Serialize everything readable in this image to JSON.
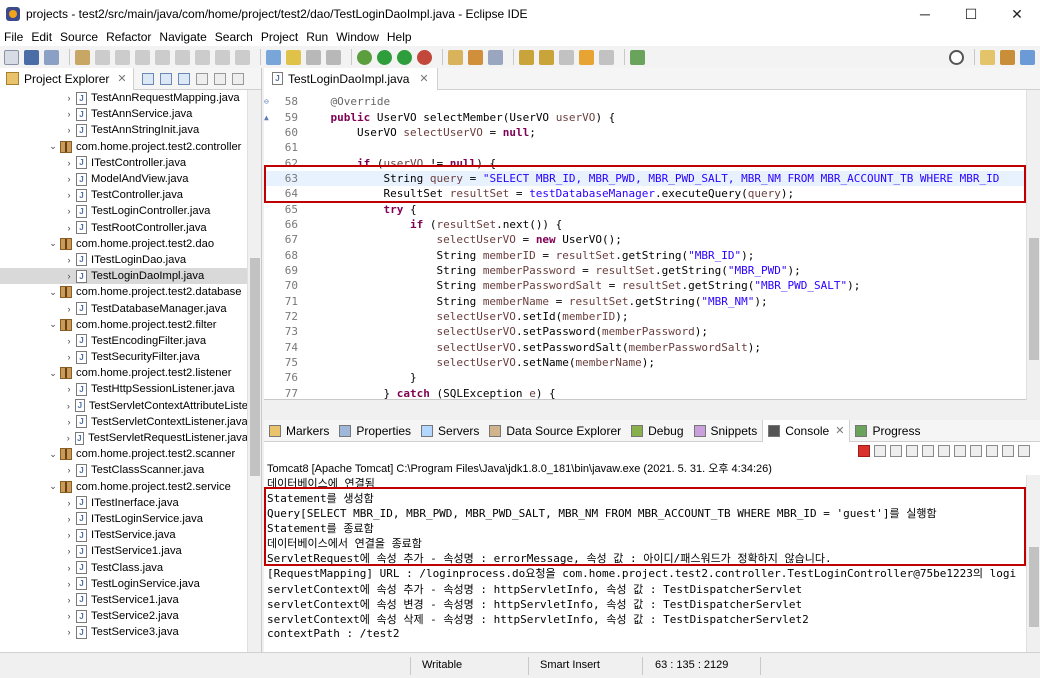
{
  "window": {
    "title": "projects - test2/src/main/java/com/home/project/test2/dao/TestLoginDaoImpl.java - Eclipse IDE",
    "minimize": "─",
    "maximize": "☐",
    "close": "✕"
  },
  "menu": [
    "File",
    "Edit",
    "Source",
    "Refactor",
    "Navigate",
    "Search",
    "Project",
    "Run",
    "Window",
    "Help"
  ],
  "project_explorer": {
    "title": "Project Explorer",
    "close": "✕",
    "rows": [
      {
        "label": "TestAnnRequestMapping.java",
        "kind": "java",
        "indent": 1
      },
      {
        "label": "TestAnnService.java",
        "kind": "java",
        "indent": 1
      },
      {
        "label": "TestAnnStringInit.java",
        "kind": "java",
        "indent": 1
      },
      {
        "label": "com.home.project.test2.controller",
        "kind": "package",
        "indent": 0
      },
      {
        "label": "ITestController.java",
        "kind": "java",
        "indent": 1
      },
      {
        "label": "ModelAndView.java",
        "kind": "java",
        "indent": 1
      },
      {
        "label": "TestController.java",
        "kind": "java",
        "indent": 1
      },
      {
        "label": "TestLoginController.java",
        "kind": "java",
        "indent": 1
      },
      {
        "label": "TestRootController.java",
        "kind": "java",
        "indent": 1
      },
      {
        "label": "com.home.project.test2.dao",
        "kind": "package",
        "indent": 0
      },
      {
        "label": "ITestLoginDao.java",
        "kind": "java",
        "indent": 1
      },
      {
        "label": "TestLoginDaoImpl.java",
        "kind": "java",
        "indent": 1,
        "selected": true
      },
      {
        "label": "com.home.project.test2.database",
        "kind": "package",
        "indent": 0
      },
      {
        "label": "TestDatabaseManager.java",
        "kind": "java",
        "indent": 1
      },
      {
        "label": "com.home.project.test2.filter",
        "kind": "package",
        "indent": 0
      },
      {
        "label": "TestEncodingFilter.java",
        "kind": "java",
        "indent": 1
      },
      {
        "label": "TestSecurityFilter.java",
        "kind": "java",
        "indent": 1
      },
      {
        "label": "com.home.project.test2.listener",
        "kind": "package",
        "indent": 0
      },
      {
        "label": "TestHttpSessionListener.java",
        "kind": "java",
        "indent": 1
      },
      {
        "label": "TestServletContextAttributeListe",
        "kind": "java",
        "indent": 1
      },
      {
        "label": "TestServletContextListener.java",
        "kind": "java",
        "indent": 1
      },
      {
        "label": "TestServletRequestListener.java",
        "kind": "java",
        "indent": 1
      },
      {
        "label": "com.home.project.test2.scanner",
        "kind": "package",
        "indent": 0
      },
      {
        "label": "TestClassScanner.java",
        "kind": "java",
        "indent": 1
      },
      {
        "label": "com.home.project.test2.service",
        "kind": "package",
        "indent": 0
      },
      {
        "label": "ITestInerface.java",
        "kind": "java",
        "indent": 1
      },
      {
        "label": "ITestLoginService.java",
        "kind": "java",
        "indent": 1
      },
      {
        "label": "ITestService.java",
        "kind": "java",
        "indent": 1
      },
      {
        "label": "ITestService1.java",
        "kind": "java",
        "indent": 1
      },
      {
        "label": "TestClass.java",
        "kind": "java",
        "indent": 1
      },
      {
        "label": "TestLoginService.java",
        "kind": "java",
        "indent": 1
      },
      {
        "label": "TestService1.java",
        "kind": "java",
        "indent": 1
      },
      {
        "label": "TestService2.java",
        "kind": "java",
        "indent": 1
      },
      {
        "label": "TestService3.java",
        "kind": "java",
        "indent": 1
      }
    ]
  },
  "editor": {
    "tab_label": "TestLoginDaoImpl.java",
    "close": "✕",
    "lines": [
      {
        "n": "58",
        "marker": "⊖",
        "tokens": [
          [
            "    ",
            ""
          ],
          [
            "@Override",
            "ann"
          ]
        ]
      },
      {
        "n": "59",
        "marker": "▲",
        "tokens": [
          [
            "    ",
            ""
          ],
          [
            "public",
            "kw"
          ],
          [
            " UserVO selectMember(UserVO ",
            ""
          ],
          [
            "userVO",
            "var"
          ],
          [
            ") {",
            ""
          ]
        ]
      },
      {
        "n": "60",
        "tokens": [
          [
            "        UserVO ",
            ""
          ],
          [
            "selectUserVO",
            "var"
          ],
          [
            " = ",
            ""
          ],
          [
            "null",
            "kw"
          ],
          [
            ";",
            ""
          ]
        ]
      },
      {
        "n": "61",
        "tokens": [
          [
            "",
            ""
          ]
        ]
      },
      {
        "n": "62",
        "tokens": [
          [
            "        ",
            ""
          ],
          [
            "if",
            "kw"
          ],
          [
            " (",
            ""
          ],
          [
            "userVO",
            "var"
          ],
          [
            " != ",
            ""
          ],
          [
            "null",
            "kw"
          ],
          [
            ") {",
            ""
          ]
        ]
      },
      {
        "n": "63",
        "hl": true,
        "tokens": [
          [
            "            String ",
            ""
          ],
          [
            "query",
            "var"
          ],
          [
            " = ",
            ""
          ],
          [
            "\"SELECT MBR_ID, MBR_PWD, MBR_PWD_SALT, MBR_NM FROM MBR_ACCOUNT_TB WHERE MBR_ID",
            "str"
          ]
        ]
      },
      {
        "n": "64",
        "tokens": [
          [
            "            ResultSet ",
            ""
          ],
          [
            "resultSet",
            "var"
          ],
          [
            " = ",
            ""
          ],
          [
            "testDatabaseManager",
            "str"
          ],
          [
            ".executeQuery(",
            ""
          ],
          [
            "query",
            "var"
          ],
          [
            ");",
            ""
          ]
        ]
      },
      {
        "n": "65",
        "tokens": [
          [
            "            ",
            ""
          ],
          [
            "try",
            "kw"
          ],
          [
            " {",
            ""
          ]
        ]
      },
      {
        "n": "66",
        "tokens": [
          [
            "                ",
            ""
          ],
          [
            "if",
            "kw"
          ],
          [
            " (",
            ""
          ],
          [
            "resultSet",
            "var"
          ],
          [
            ".next()) {",
            ""
          ]
        ]
      },
      {
        "n": "67",
        "tokens": [
          [
            "                    ",
            ""
          ],
          [
            "selectUserVO",
            "var"
          ],
          [
            " = ",
            ""
          ],
          [
            "new",
            "kw"
          ],
          [
            " UserVO();",
            ""
          ]
        ]
      },
      {
        "n": "68",
        "tokens": [
          [
            "                    String ",
            ""
          ],
          [
            "memberID",
            "var"
          ],
          [
            " = ",
            ""
          ],
          [
            "resultSet",
            "var"
          ],
          [
            ".getString(",
            ""
          ],
          [
            "\"MBR_ID\"",
            "str"
          ],
          [
            ");",
            ""
          ]
        ]
      },
      {
        "n": "69",
        "tokens": [
          [
            "                    String ",
            ""
          ],
          [
            "memberPassword",
            "var"
          ],
          [
            " = ",
            ""
          ],
          [
            "resultSet",
            "var"
          ],
          [
            ".getString(",
            ""
          ],
          [
            "\"MBR_PWD\"",
            "str"
          ],
          [
            ");",
            ""
          ]
        ]
      },
      {
        "n": "70",
        "tokens": [
          [
            "                    String ",
            ""
          ],
          [
            "memberPasswordSalt",
            "var"
          ],
          [
            " = ",
            ""
          ],
          [
            "resultSet",
            "var"
          ],
          [
            ".getString(",
            ""
          ],
          [
            "\"MBR_PWD_SALT\"",
            "str"
          ],
          [
            ");",
            ""
          ]
        ]
      },
      {
        "n": "71",
        "tokens": [
          [
            "                    String ",
            ""
          ],
          [
            "memberName",
            "var"
          ],
          [
            " = ",
            ""
          ],
          [
            "resultSet",
            "var"
          ],
          [
            ".getString(",
            ""
          ],
          [
            "\"MBR_NM\"",
            "str"
          ],
          [
            ");",
            ""
          ]
        ]
      },
      {
        "n": "72",
        "tokens": [
          [
            "                    ",
            ""
          ],
          [
            "selectUserVO",
            "var"
          ],
          [
            ".setId(",
            ""
          ],
          [
            "memberID",
            "var"
          ],
          [
            ");",
            ""
          ]
        ]
      },
      {
        "n": "73",
        "tokens": [
          [
            "                    ",
            ""
          ],
          [
            "selectUserVO",
            "var"
          ],
          [
            ".setPassword(",
            ""
          ],
          [
            "memberPassword",
            "var"
          ],
          [
            ");",
            ""
          ]
        ]
      },
      {
        "n": "74",
        "tokens": [
          [
            "                    ",
            ""
          ],
          [
            "selectUserVO",
            "var"
          ],
          [
            ".setPasswordSalt(",
            ""
          ],
          [
            "memberPasswordSalt",
            "var"
          ],
          [
            ");",
            ""
          ]
        ]
      },
      {
        "n": "75",
        "tokens": [
          [
            "                    ",
            ""
          ],
          [
            "selectUserVO",
            "var"
          ],
          [
            ".setName(",
            ""
          ],
          [
            "memberName",
            "var"
          ],
          [
            ");",
            ""
          ]
        ]
      },
      {
        "n": "76",
        "tokens": [
          [
            "                }",
            ""
          ]
        ]
      },
      {
        "n": "77",
        "tokens": [
          [
            "            } ",
            ""
          ],
          [
            "catch",
            "kw"
          ],
          [
            " (SQLException ",
            ""
          ],
          [
            "e",
            "var"
          ],
          [
            ") {",
            ""
          ]
        ]
      }
    ]
  },
  "console_panel": {
    "tabs": [
      {
        "label": "Markers"
      },
      {
        "label": "Properties"
      },
      {
        "label": "Servers"
      },
      {
        "label": "Data Source Explorer"
      },
      {
        "label": "Debug"
      },
      {
        "label": "Snippets"
      },
      {
        "label": "Console",
        "active": true
      },
      {
        "label": "Progress"
      }
    ],
    "close": "✕",
    "description": "Tomcat8 [Apache Tomcat] C:\\Program Files\\Java\\jdk1.8.0_181\\bin\\javaw.exe  (2021. 5. 31. 오후 4:34:26)",
    "lines": [
      "데이터베이스에 연결됨",
      "Statement를 생성함",
      "Query[SELECT MBR_ID, MBR_PWD, MBR_PWD_SALT, MBR_NM FROM MBR_ACCOUNT_TB WHERE MBR_ID = 'guest']를 실행함",
      "Statement를 종료함",
      "데이터베이스에서 연결을 종료함",
      "ServletRequest에 속성 추가 - 속성명 : errorMessage, 속성 값 : 아이디/패스워드가 정확하지 않습니다.",
      "[RequestMapping] URL : /loginprocess.do요청을 com.home.project.test2.controller.TestLoginController@75be1223의 logi",
      "servletContext에 속성 추가 - 속성명 : httpServletInfo, 속성 값 : TestDispatcherServlet",
      "servletContext에 속성 변경 - 속성명 : httpServletInfo, 속성 값 : TestDispatcherServlet",
      "servletContext에 속성 삭제 - 속성명 : httpServletInfo, 속성 값 : TestDispatcherServlet2",
      "contextPath : /test2"
    ]
  },
  "status": {
    "writable": "Writable",
    "insert_mode": "Smart Insert",
    "position": "63 : 135 : 2129"
  }
}
